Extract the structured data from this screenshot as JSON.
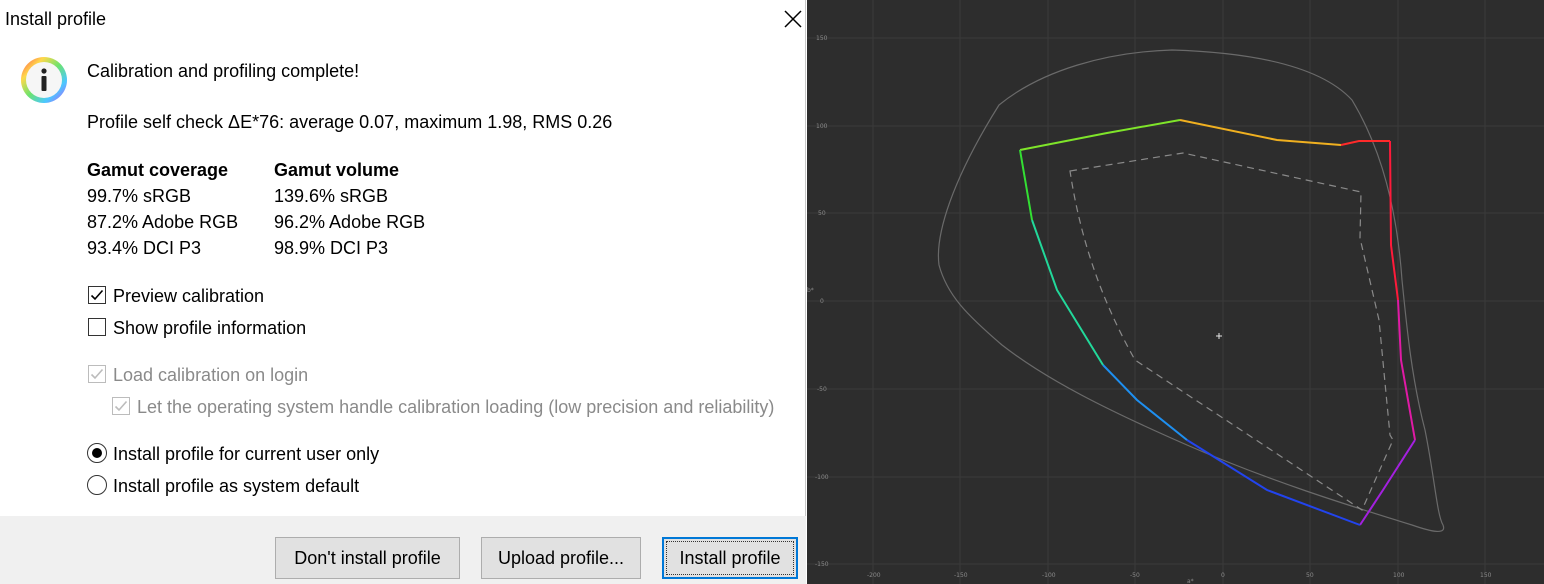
{
  "window": {
    "title": "Install profile"
  },
  "message": {
    "heading": "Calibration and profiling complete!",
    "self_check": "Profile self check ΔE*76: average 0.07, maximum 1.98, RMS 0.26"
  },
  "gamut": {
    "coverage_header": "Gamut coverage",
    "volume_header": "Gamut volume",
    "coverage": [
      "99.7% sRGB",
      "87.2% Adobe RGB",
      "93.4% DCI P3"
    ],
    "volume": [
      "139.6% sRGB",
      "96.2% Adobe RGB",
      "98.9% DCI P3"
    ]
  },
  "options": {
    "preview_calibration": {
      "label": "Preview calibration",
      "checked": true
    },
    "show_profile_info": {
      "label": "Show profile information",
      "checked": false
    },
    "load_calibration": {
      "label": "Load calibration on login",
      "checked": true,
      "enabled": false
    },
    "os_handle": {
      "label": "Let the operating system handle calibration loading (low precision and reliability)",
      "checked": true,
      "enabled": false
    }
  },
  "install_scope": {
    "current_user": {
      "label": "Install profile for current user only",
      "selected": true
    },
    "system_default": {
      "label": "Install profile as system default",
      "selected": false
    }
  },
  "buttons": {
    "dont_install": "Don't install profile",
    "upload": "Upload profile...",
    "install": "Install profile"
  },
  "icons": {
    "info": "info-icon",
    "close": "close-icon",
    "checkmark": "checkmark-icon"
  },
  "plot": {
    "background": "#2d2d2d",
    "grid_color": "#3a3a3a",
    "y_ticks": [
      "150",
      "100",
      "50",
      "0",
      "-50",
      "-100",
      "-150"
    ],
    "x_ticks": [
      "-200",
      "-150",
      "-100",
      "-50",
      "0",
      "50",
      "100",
      "150"
    ],
    "x_axis_label": "a*",
    "y_axis_label": "b*",
    "gamut_colors": {
      "green": "#22dd22",
      "yellow": "#dddd00",
      "red": "#ff2020",
      "magenta": "#dd22dd",
      "blue": "#2244ee",
      "cyan": "#22ccee"
    }
  }
}
